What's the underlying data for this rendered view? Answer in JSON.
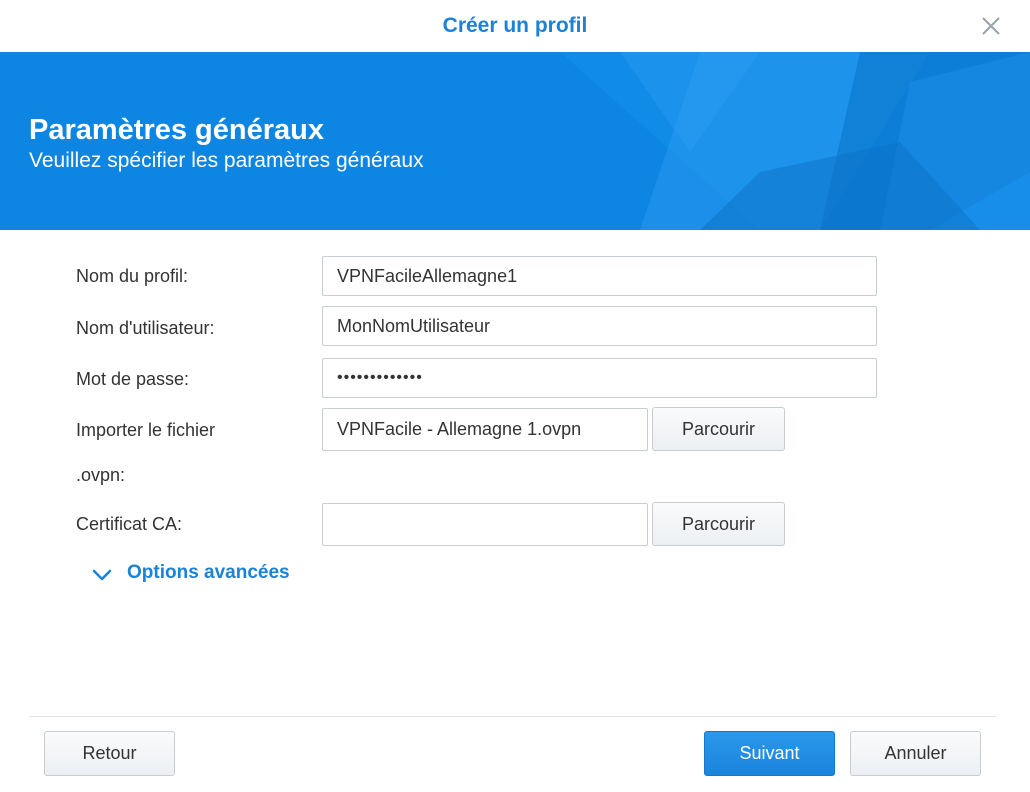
{
  "dialog": {
    "title": "Créer un profil",
    "close_icon": "close-icon"
  },
  "banner": {
    "heading": "Paramètres généraux",
    "subheading": "Veuillez spécifier les paramètres généraux",
    "color": "#0e86e2"
  },
  "form": {
    "profile_name": {
      "label": "Nom du profil:",
      "value": "VPNFacileAllemagne1"
    },
    "username": {
      "label": "Nom d'utilisateur:",
      "value": "MonNomUtilisateur"
    },
    "password": {
      "label": "Mot de passe:",
      "value": "•••••••••••••"
    },
    "import_file": {
      "label_line1": "Importer le fichier",
      "label_line2": ".ovpn:",
      "value": "VPNFacile - Allemagne 1.ovpn",
      "browse_label": "Parcourir"
    },
    "ca_cert": {
      "label": "Certificat CA:",
      "value": "",
      "browse_label": "Parcourir"
    },
    "advanced_options": {
      "label": "Options avancées",
      "icon": "chevron-down-icon"
    }
  },
  "footer": {
    "back_label": "Retour",
    "next_label": "Suivant",
    "cancel_label": "Annuler"
  },
  "colors": {
    "accent": "#1a82d9",
    "primary_button": "#1a84dc"
  }
}
